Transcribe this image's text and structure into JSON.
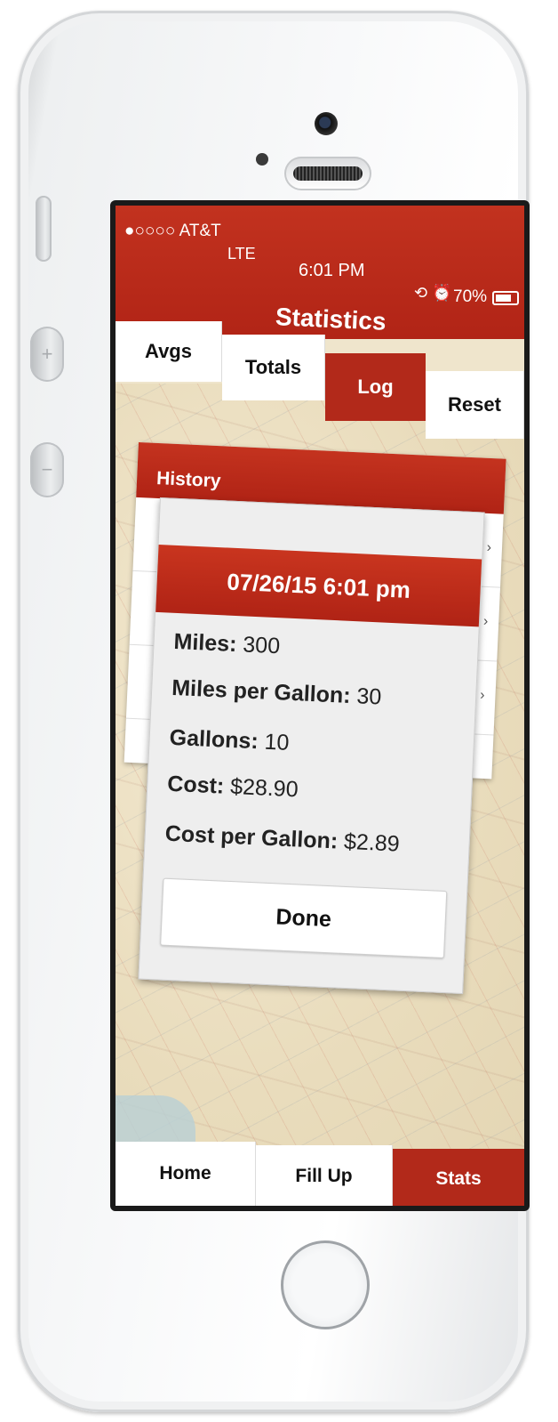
{
  "status_bar": {
    "carrier": "●○○○○ AT&T",
    "network": "LTE",
    "time": "6:01 PM",
    "icons": "⟲ ⏰",
    "battery_percent": "70%"
  },
  "header": {
    "title": "Statistics"
  },
  "tabs": [
    {
      "label": "Avgs"
    },
    {
      "label": "Totals"
    },
    {
      "label": "Log",
      "selected": true
    },
    {
      "label": "Reset"
    }
  ],
  "history": {
    "title": "History"
  },
  "popup": {
    "title": "07/26/15 6:01 pm",
    "fields": [
      {
        "label": "Miles:",
        "value": "300"
      },
      {
        "label": "Miles per Gallon:",
        "value": "30"
      },
      {
        "label": "Gallons:",
        "value": "10"
      },
      {
        "label": "Cost:",
        "value": "$28.90"
      },
      {
        "label": "Cost per Gallon:",
        "value": "$2.89"
      }
    ],
    "done_label": "Done"
  },
  "bottom_tabs": [
    {
      "label": "Home"
    },
    {
      "label": "Fill Up"
    },
    {
      "label": "Stats",
      "selected": true
    }
  ],
  "colors": {
    "accent": "#b2291a",
    "header": "#c2321f",
    "map_base": "#efe5cc"
  }
}
